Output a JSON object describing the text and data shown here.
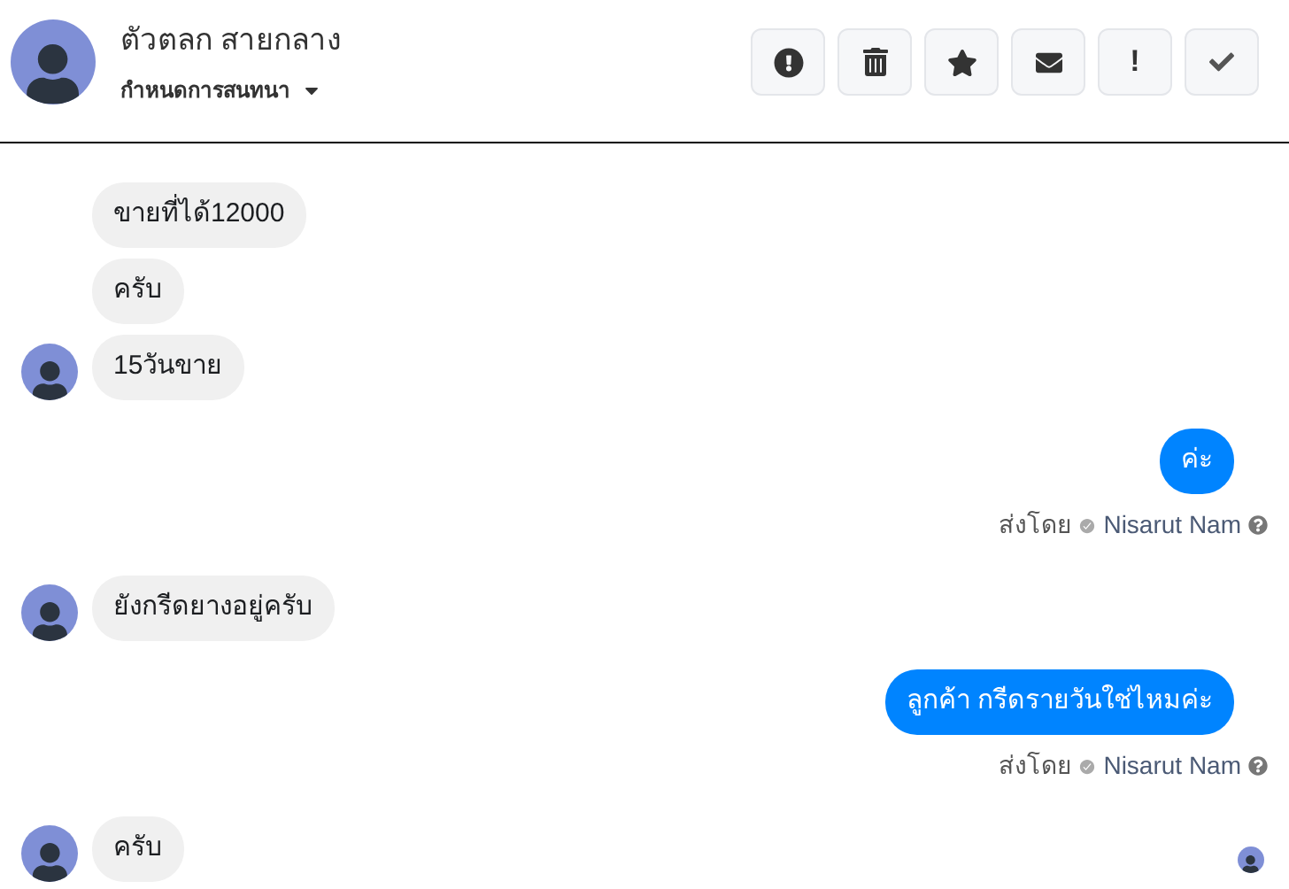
{
  "header": {
    "name": "ตัวตลก สายกลาง",
    "subtitle": "กำหนดการสนทนา"
  },
  "actions": [
    {
      "kind": "alert"
    },
    {
      "kind": "trash"
    },
    {
      "kind": "star"
    },
    {
      "kind": "mail"
    },
    {
      "kind": "exclaim",
      "label": "!"
    },
    {
      "kind": "check"
    }
  ],
  "messages": [
    {
      "kind": "incoming",
      "text": "ขายที่ได้12000",
      "avatar": false
    },
    {
      "kind": "incoming",
      "text": "ครับ",
      "avatar": false
    },
    {
      "kind": "incoming",
      "text": "15วันขาย",
      "avatar": true
    },
    {
      "kind": "outgoing",
      "text": "ค่ะ",
      "sent_label": "ส่งโดย",
      "sender": "Nisarut Nam"
    },
    {
      "kind": "incoming",
      "text": "ยังกรีดยางอยู่ครับ",
      "avatar": true
    },
    {
      "kind": "outgoing",
      "text": "ลูกค้า กรีดรายวันใช่ไหมค่ะ",
      "sent_label": "ส่งโดย",
      "sender": "Nisarut Nam"
    },
    {
      "kind": "incoming",
      "text": "ครับ",
      "avatar": true,
      "seen": true
    }
  ]
}
